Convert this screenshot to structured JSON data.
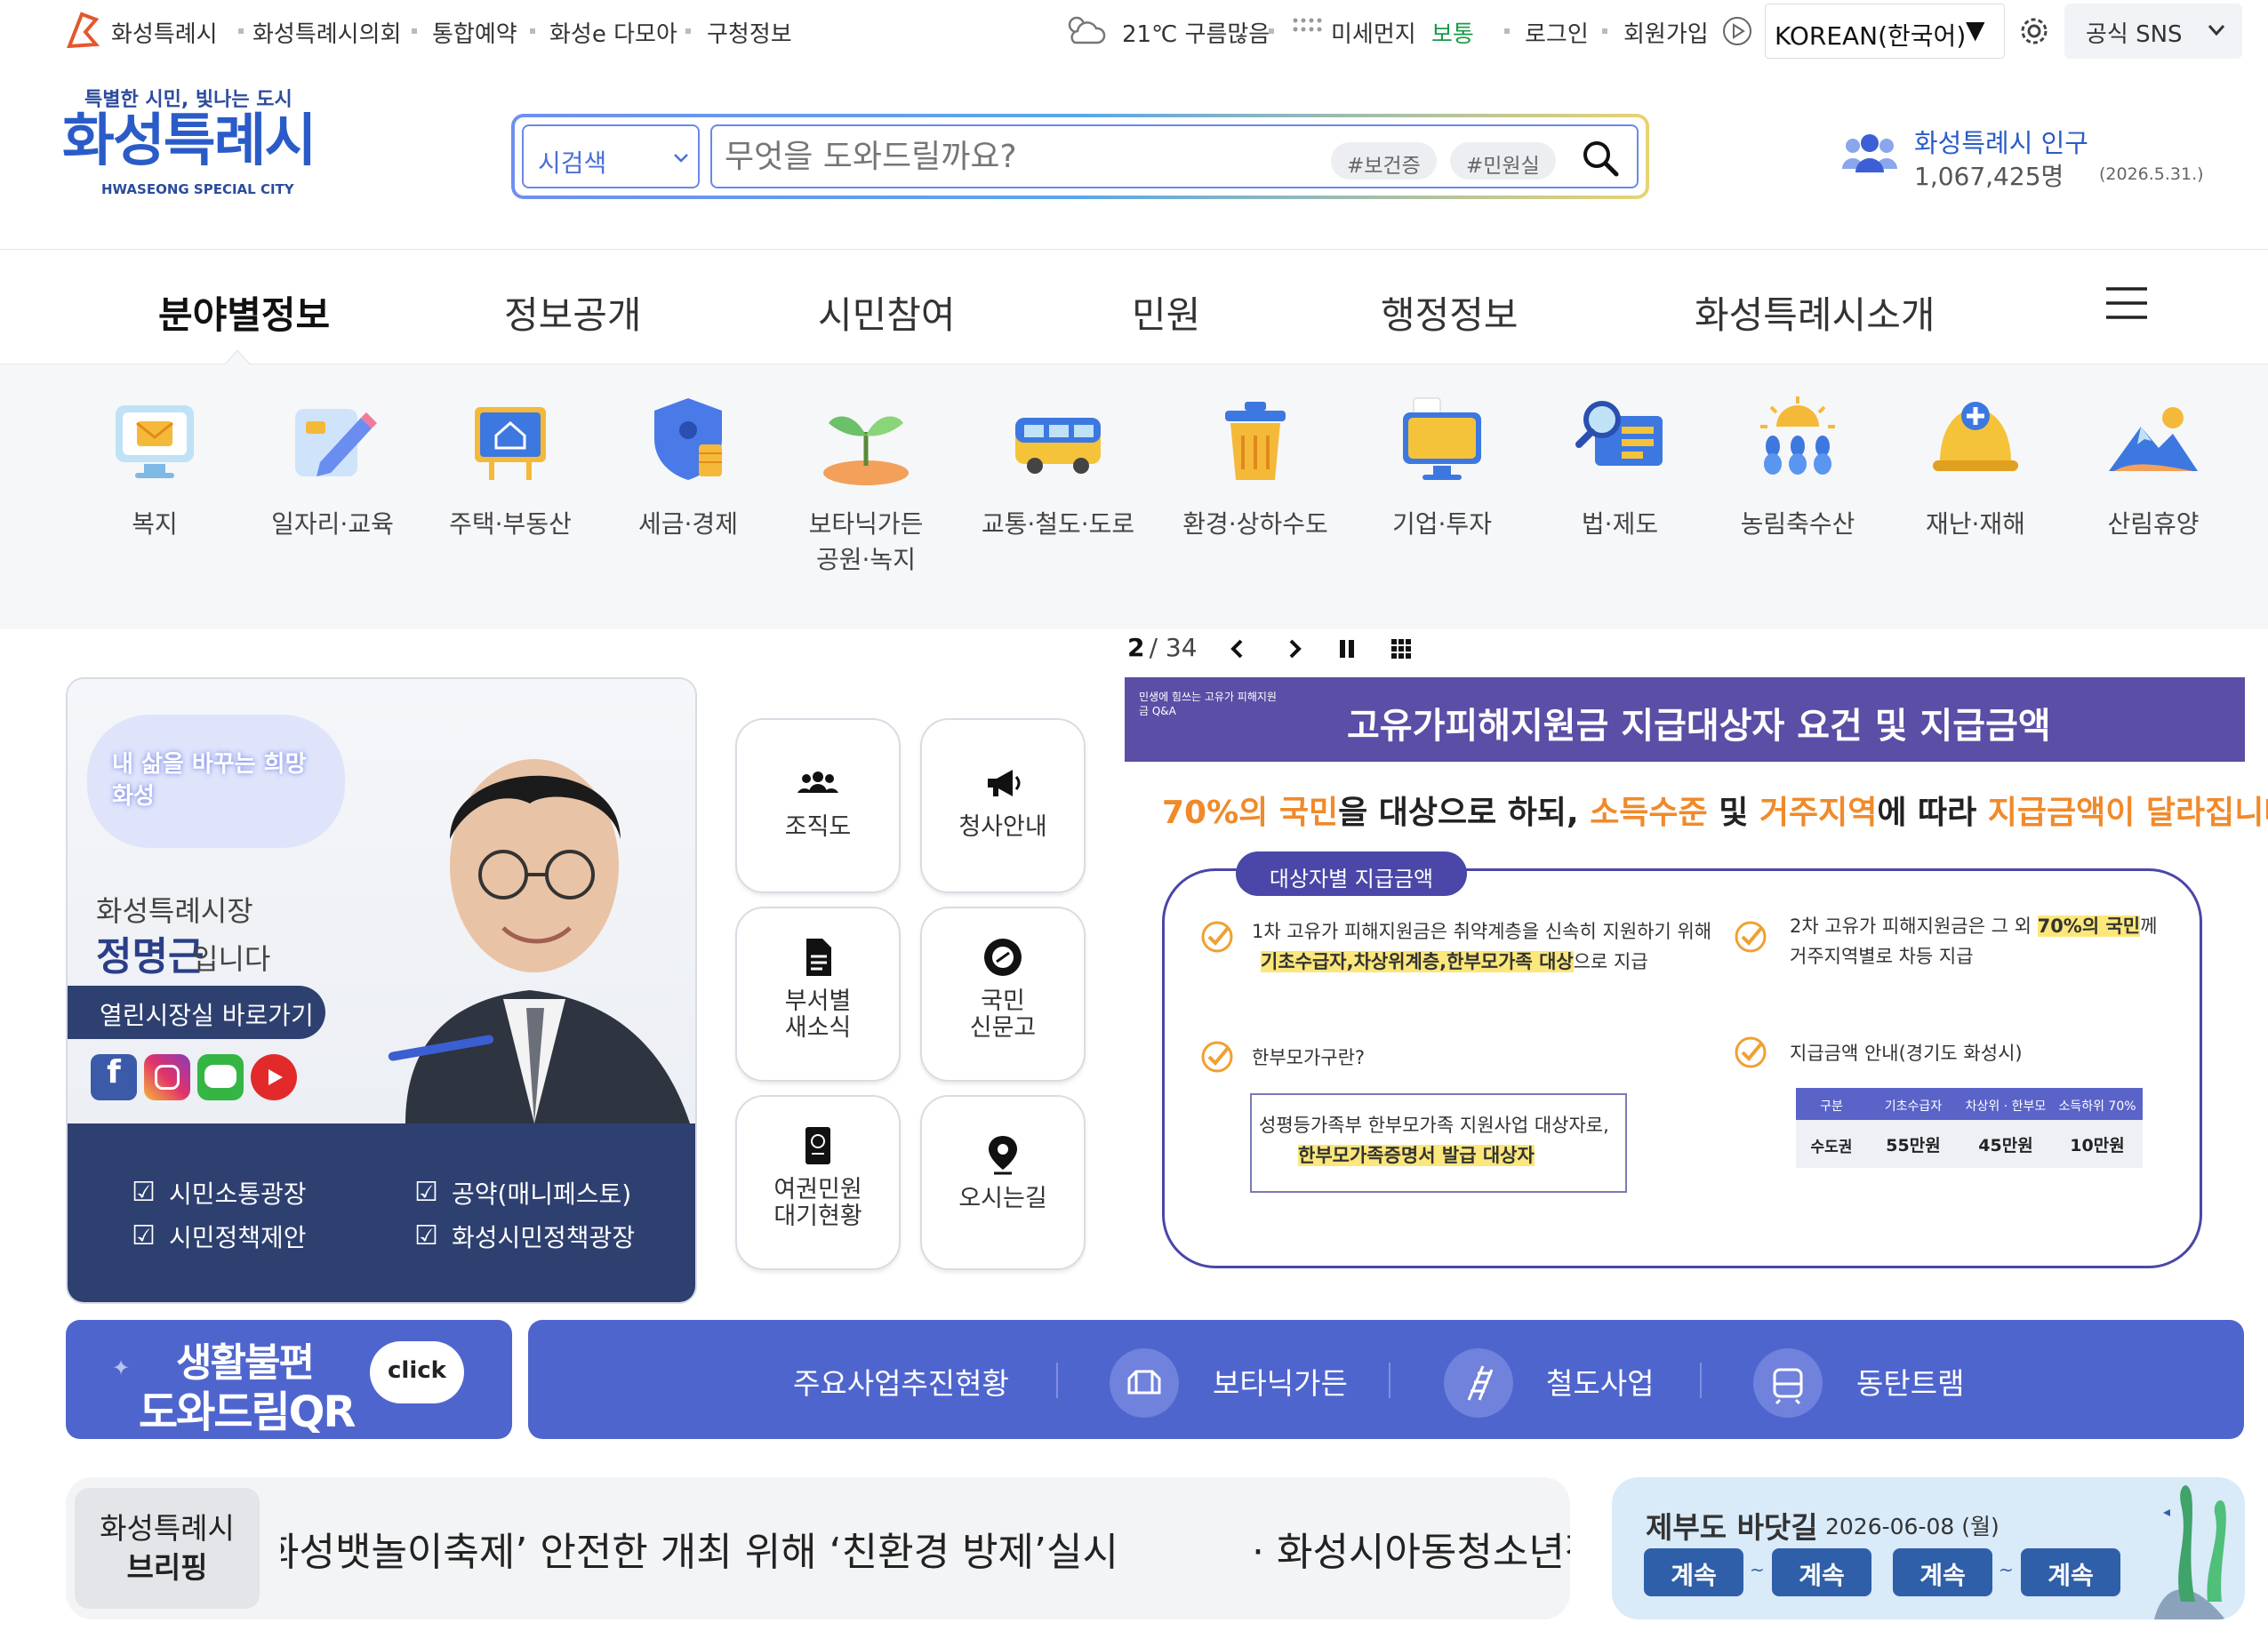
{
  "topbar": {
    "links": [
      "화성특례시",
      "화성특례시의회",
      "통합예약",
      "화성e 다모아",
      "구청정보"
    ],
    "weather": "21℃ 구름많음",
    "dust_label": "미세먼지",
    "dust_value": "보통",
    "login": "로그인",
    "signup": "회원가입",
    "language": "KOREAN(한국어)",
    "sns": "공식 SNS"
  },
  "header": {
    "slogan": "특별한 시민, 빛나는 도시",
    "logo_text": "화성특례시",
    "logo_sub": "HWASEONG SPECIAL CITY",
    "search_type": "시검색",
    "search_placeholder": "무엇을 도와드릴까요?",
    "tags": [
      "#보건증",
      "#민원실"
    ],
    "population_label": "화성특례시 인구",
    "population_value": "1,067,425명",
    "population_date": "(2026.5.31.)"
  },
  "gnb": [
    "분야별정보",
    "정보공개",
    "시민참여",
    "민원",
    "행정정보",
    "화성특례시소개"
  ],
  "categories": [
    {
      "label": "복지",
      "icon": "monitor-mail-icon"
    },
    {
      "label": "일자리·교육",
      "icon": "pencil-note-icon"
    },
    {
      "label": "주택·부동산",
      "icon": "house-board-icon"
    },
    {
      "label": "세금·경제",
      "icon": "shield-coin-icon"
    },
    {
      "label": "보타닉가든\n공원·녹지",
      "icon": "sprout-icon"
    },
    {
      "label": "교통·철도·도로",
      "icon": "bus-icon"
    },
    {
      "label": "환경·상하수도",
      "icon": "trash-bin-icon"
    },
    {
      "label": "기업·투자",
      "icon": "monitor-icon"
    },
    {
      "label": "법·제도",
      "icon": "magnifier-doc-icon"
    },
    {
      "label": "농림축수산",
      "icon": "sun-crops-icon"
    },
    {
      "label": "재난·재해",
      "icon": "helmet-icon"
    },
    {
      "label": "산림휴양",
      "icon": "mountain-icon"
    }
  ],
  "mayor": {
    "badge": "내 삶을 바꾸는 희망화성",
    "title": "화성특례시장",
    "name": "정명근",
    "suffix": "입니다",
    "open_btn": "열린시장실 바로가기",
    "links": [
      "시민소통광장",
      "공약(매니페스토)",
      "시민정책제안",
      "화성시민정책광장"
    ]
  },
  "quick": [
    {
      "label": "조직도",
      "icon": "people-icon"
    },
    {
      "label": "청사안내",
      "icon": "megaphone-icon"
    },
    {
      "label": "부서별\n새소식",
      "icon": "document-icon"
    },
    {
      "label": "국민\n신문고",
      "icon": "drum-icon"
    },
    {
      "label": "여권민원\n대기현황",
      "icon": "passport-icon"
    },
    {
      "label": "오시는길",
      "icon": "location-pin-icon"
    }
  ],
  "slider": {
    "current": "2",
    "total": "34"
  },
  "banner": {
    "corner": "민생에 힘쓰는 고유가 피해지원금 Q&A",
    "title": "고유가피해지원금 지급대상자 요건 및 지급금액",
    "sub_parts": [
      "70%의 국민",
      "을 대상으로 하되, ",
      "소득수준",
      " 및 ",
      "거주지역",
      "에 따라 ",
      "지급금액이 달라집니다."
    ],
    "box_tag": "대상자별 지급금액",
    "p1_line1": "1차 고유가 피해지원금은 취약계층을 신속히 지원하기 위해",
    "p1_line2_hl": "기초수급자,차상위계층,한부모가족 대상",
    "p1_line2_rest": "으로 지급",
    "p2_line1_pre": "2차 고유가 피해지원금은 그 외 ",
    "p2_line1_hl": "70%의 국민",
    "p2_line1_post": "께",
    "p2_line2": "거주지역별로 차등 지급",
    "q_single": "한부모가구란?",
    "single_def1": "성평등가족부 한부모가족 지원사업 대상자로,",
    "single_def2": "한부모가족증명서 발급 대상자",
    "amount_title": "지급금액 안내(경기도 화성시)",
    "table_headers": [
      "구분",
      "기초수급자",
      "차상위 · 한부모",
      "소득하위 70%"
    ],
    "table_row": [
      "수도권",
      "55만원",
      "45만원",
      "10만원"
    ]
  },
  "qr": {
    "line1": "생활불편",
    "line2": "도와드림QR",
    "click": "click"
  },
  "projects": [
    "주요사업추진현황",
    "보타닉가든",
    "철도사업",
    "동탄트램"
  ],
  "briefing": {
    "label1": "화성특례시",
    "label2": "브리핑",
    "news1": "화성뱃놀이축제’ 안전한 개최 위해 ‘친환경 방제’실시",
    "news2": "· 화성시아동청소년정"
  },
  "sea": {
    "title": "제부도 바닷길",
    "date": "2026-06-08 (월)",
    "pills": [
      "계속",
      "계속",
      "계속",
      "계속"
    ]
  }
}
